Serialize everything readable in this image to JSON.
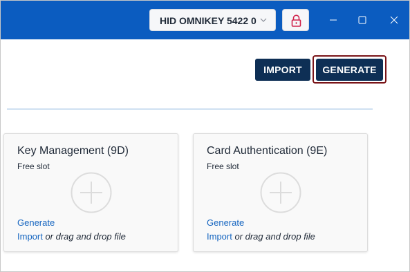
{
  "header": {
    "device_selector": {
      "value": "HID OMNIKEY 5422 0",
      "icon": "chevron-down-icon"
    },
    "lock_button": {
      "icon": "lock-icon",
      "color": "#d0234c"
    },
    "window_controls": [
      "minimize-icon",
      "maximize-icon",
      "close-icon"
    ],
    "colors": {
      "titlebar": "#0b5cc0"
    }
  },
  "toolbar": {
    "import_label": "IMPORT",
    "generate_label": "GENERATE",
    "button_color": "#0e2f55",
    "generate_focus_color": "#7a1418"
  },
  "slots": [
    {
      "title": "Key Management (9D)",
      "status": "Free slot",
      "generate_label": "Generate",
      "import_label": "Import",
      "drop_text": " or drag and drop file"
    },
    {
      "title": "Card Authentication (9E)",
      "status": "Free slot",
      "generate_label": "Generate",
      "import_label": "Import",
      "drop_text": " or drag and drop file"
    }
  ],
  "link_color": "#1565c0"
}
